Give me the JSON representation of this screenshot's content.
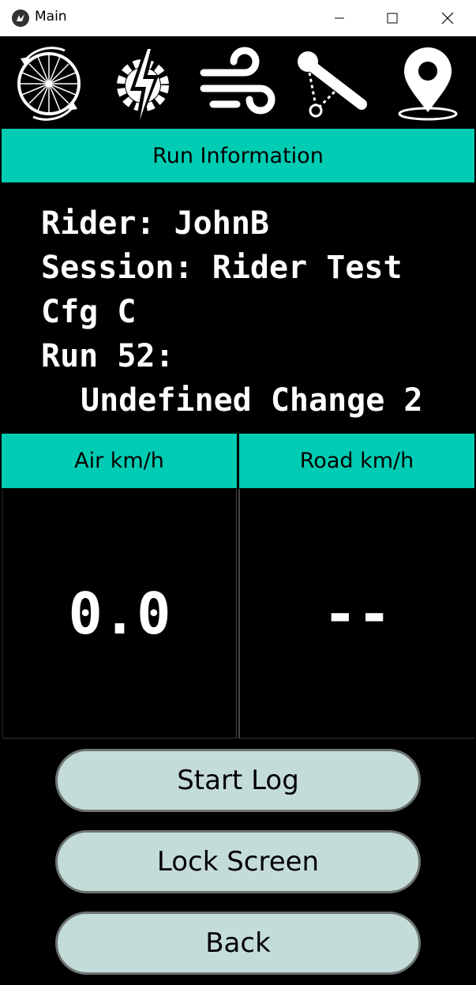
{
  "window": {
    "title": "Main",
    "app_icon": "kivy-logo-icon",
    "controls": [
      "minimize-icon",
      "maximize-icon",
      "close-icon"
    ]
  },
  "nav_icons": [
    "wheel-rotation-icon",
    "power-gear-icon",
    "wind-icon",
    "linkage-icon",
    "map-pin-icon"
  ],
  "run_info": {
    "header": "Run Information",
    "rider": "Rider: JohnB",
    "session": "Session: Rider Test",
    "config": "Cfg C",
    "run": "Run 52:",
    "run_detail": "Undefined Change 2"
  },
  "speeds": {
    "air_label": "Air km/h",
    "air_value": "0.0",
    "road_label": "Road km/h",
    "road_value": "--"
  },
  "buttons": {
    "start_log": "Start Log",
    "lock_screen": "Lock Screen",
    "back": "Back"
  },
  "colors": {
    "accent": "#00ccb3",
    "button_fill": "#c4dcd9",
    "background": "#000000"
  }
}
